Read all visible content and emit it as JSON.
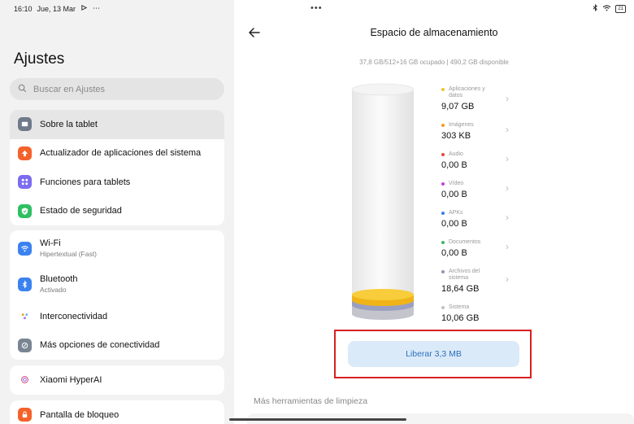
{
  "status_bar": {
    "time": "16:10",
    "date": "Jue, 13 Mar",
    "extra": "⋯",
    "battery": "21"
  },
  "sidebar": {
    "title": "Ajustes",
    "search_placeholder": "Buscar en Ajustes",
    "groups": [
      {
        "items": [
          {
            "label": "Sobre la tablet",
            "icon": "tablet-icon",
            "color": "#6f7a8a",
            "active": true
          },
          {
            "label": "Actualizador de aplicaciones del sistema",
            "icon": "arrow-up-icon",
            "color": "#f4622a"
          },
          {
            "label": "Funciones para tablets",
            "icon": "grid-icon",
            "color": "#7b6cf0"
          },
          {
            "label": "Estado de seguridad",
            "icon": "shield-icon",
            "color": "#2fbf62"
          }
        ]
      },
      {
        "items": [
          {
            "label": "Wi-Fi",
            "sub": "Hipertextual (Fast)",
            "icon": "wifi-icon",
            "color": "#3b82f0"
          },
          {
            "label": "Bluetooth",
            "sub": "Activado",
            "icon": "bluetooth-icon",
            "color": "#3b82f0"
          },
          {
            "label": "Interconectividad",
            "icon": "interconnect-icon",
            "color": "#ffffff"
          },
          {
            "label": "Más opciones de conectividad",
            "icon": "link-icon",
            "color": "#7a8593"
          }
        ]
      },
      {
        "items": [
          {
            "label": "Xiaomi HyperAI",
            "icon": "hyperai-icon",
            "color": "#ffffff"
          }
        ]
      },
      {
        "items": [
          {
            "label": "Pantalla de bloqueo",
            "icon": "lock-icon",
            "color": "#f4622a"
          }
        ]
      }
    ]
  },
  "main": {
    "title": "Espacio de almacenamiento",
    "summary": "37,8 GB/512+16 GB ocupado | 490,2 GB disponible",
    "categories": [
      {
        "name": "Aplicaciones y datos",
        "value": "9,07 GB",
        "color": "#f6c12b"
      },
      {
        "name": "Imágenes",
        "value": "303 KB",
        "color": "#f59a23"
      },
      {
        "name": "Audio",
        "value": "0,00 B",
        "color": "#e8493a"
      },
      {
        "name": "Vídeo",
        "value": "0,00 B",
        "color": "#c43fe0"
      },
      {
        "name": "APKs",
        "value": "0,00 B",
        "color": "#3b7ee8"
      },
      {
        "name": "Documentos",
        "value": "0,00 B",
        "color": "#3ab86a"
      },
      {
        "name": "Archivos del sistema",
        "value": "18,64 GB",
        "color": "#8f96b8"
      },
      {
        "name": "Sistema",
        "value": "10,06 GB",
        "color": "#c2c2c2"
      }
    ],
    "free_button": "Liberar 3,3 MB",
    "more_tools": "Más herramientas de limpieza",
    "colors": {
      "accent": "#2c6fbe",
      "button_bg": "#dbeaf8",
      "highlight": "#d81f1f"
    }
  }
}
